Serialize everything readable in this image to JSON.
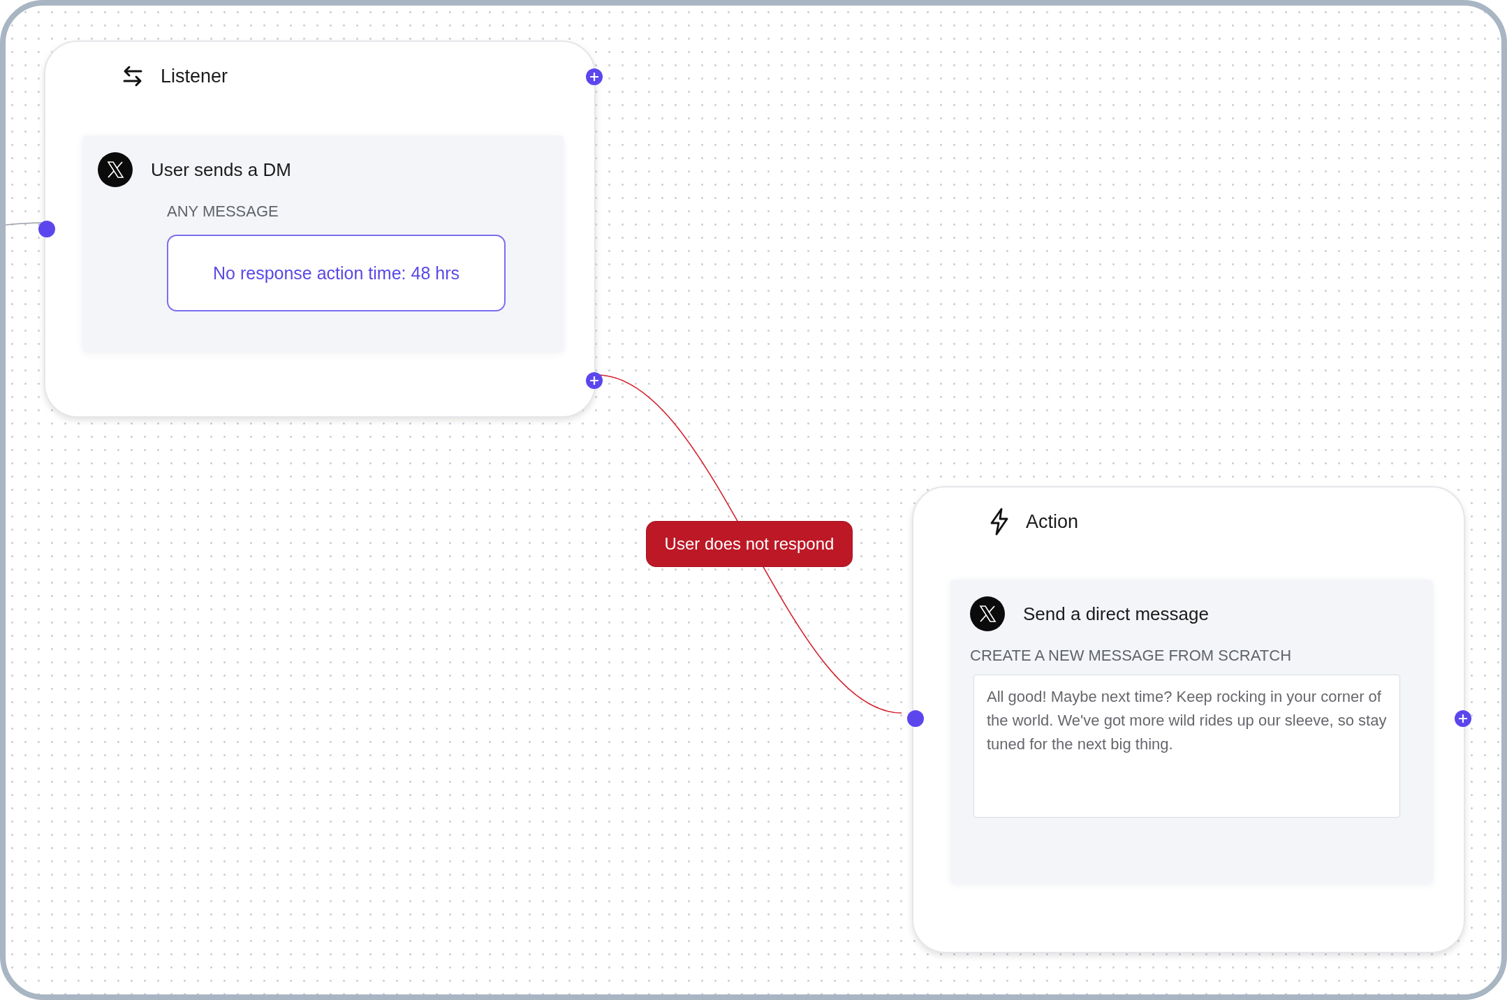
{
  "nodes": [
    {
      "kind": "listener",
      "title": "Listener",
      "step": {
        "title": "User sends a DM",
        "subtitle": "ANY MESSAGE",
        "badge": "No response action time: 48 hrs"
      }
    },
    {
      "kind": "action",
      "title": "Action",
      "step": {
        "title": "Send a direct message",
        "subtitle": "CREATE A NEW MESSAGE FROM SCRATCH",
        "message": "All good! Maybe next time? Keep rocking in your corner of the world. We've got more wild rides up our sleeve, so stay tuned for the next big thing."
      }
    }
  ],
  "edges": [
    {
      "label": "User does not respond"
    }
  ]
}
